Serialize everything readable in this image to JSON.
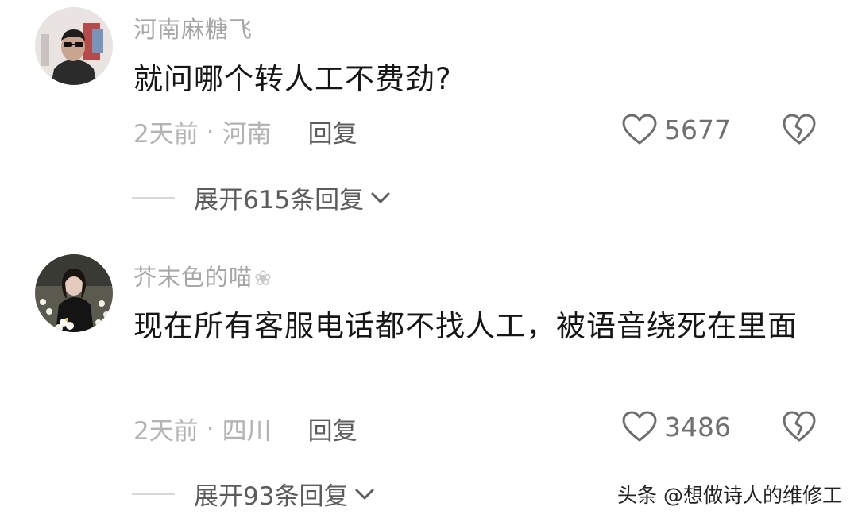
{
  "comments": [
    {
      "username": "河南麻糖飞",
      "text": "就问哪个转人工不费劲?",
      "time": "2天前",
      "separator": "·",
      "location": "河南",
      "reply_label": "回复",
      "likes": "5677",
      "expand_label": "展开615条回复"
    },
    {
      "username": "芥末色的喵",
      "username_badge": "❀",
      "text": "现在所有客服电话都不找人工，被语音绕死在里面",
      "time": "2天前",
      "separator": "·",
      "location": "四川",
      "reply_label": "回复",
      "likes": "3486",
      "expand_label": "展开93条回复"
    }
  ],
  "watermark": "头条 @想做诗人的维修工",
  "icons": {
    "like": "heart-outline-icon",
    "dislike": "broken-heart-icon",
    "expand": "chevron-down-icon"
  },
  "colors": {
    "username": "#a6a6a6",
    "text": "#161616",
    "meta": "#b3b3b3",
    "reply": "#5c5c5c"
  }
}
